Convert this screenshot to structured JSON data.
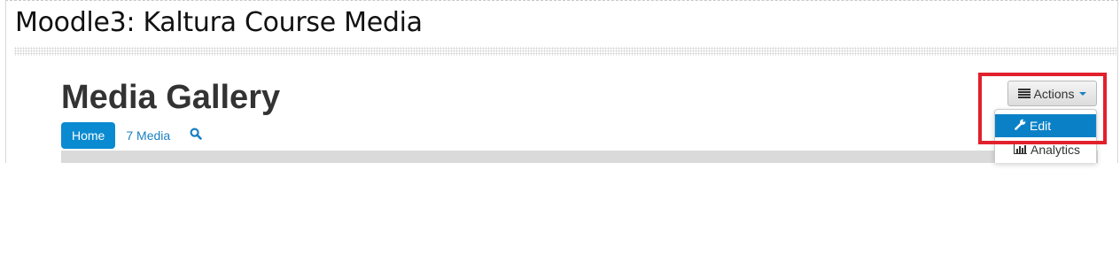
{
  "course": {
    "title": "Moodle3: Kaltura Course Media"
  },
  "gallery": {
    "title": "Media Gallery"
  },
  "tabs": [
    {
      "label": "Home",
      "active": true
    },
    {
      "label": "7 Media",
      "active": false
    }
  ],
  "search": {
    "icon": "search-icon"
  },
  "actions": {
    "label": "Actions",
    "icon": "list-icon",
    "menu": [
      {
        "label": "Edit",
        "icon": "wrench-icon",
        "highlighted": true
      },
      {
        "label": "Analytics",
        "icon": "bar-chart-icon",
        "highlighted": false
      }
    ]
  },
  "colors": {
    "accent": "#0a8ad1",
    "highlight_box": "#e1202c"
  }
}
